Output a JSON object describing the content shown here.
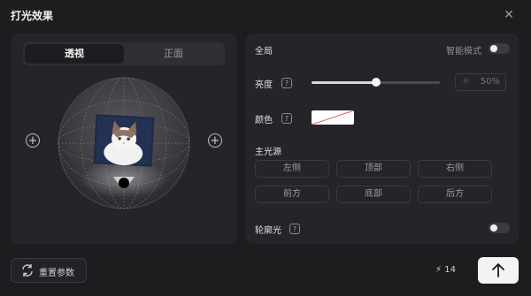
{
  "dialog": {
    "title": "打光效果",
    "close_icon": "close-icon"
  },
  "view_tabs": [
    {
      "label": "透视",
      "active": true
    },
    {
      "label": "正面",
      "active": false
    }
  ],
  "settings": {
    "global_label": "全局",
    "smart_mode_label": "智能模式",
    "smart_mode_on": false,
    "brightness_label": "亮度",
    "brightness_value": "50%",
    "brightness_fraction": 0.5,
    "color_label": "颜色",
    "color_value": "#ffffff",
    "main_light_label": "主光源",
    "light_sources": [
      "左侧",
      "顶部",
      "右侧",
      "前方",
      "底部",
      "后方"
    ],
    "rim_light_label": "轮廓光",
    "rim_light_on": false,
    "help_glyph": "?"
  },
  "footer": {
    "reset_label": "重置参数",
    "credits": "14",
    "submit_icon": "arrow-up-icon"
  },
  "colors": {
    "panel": "#252529",
    "accent_swatch_slash": "#e05a5a"
  }
}
